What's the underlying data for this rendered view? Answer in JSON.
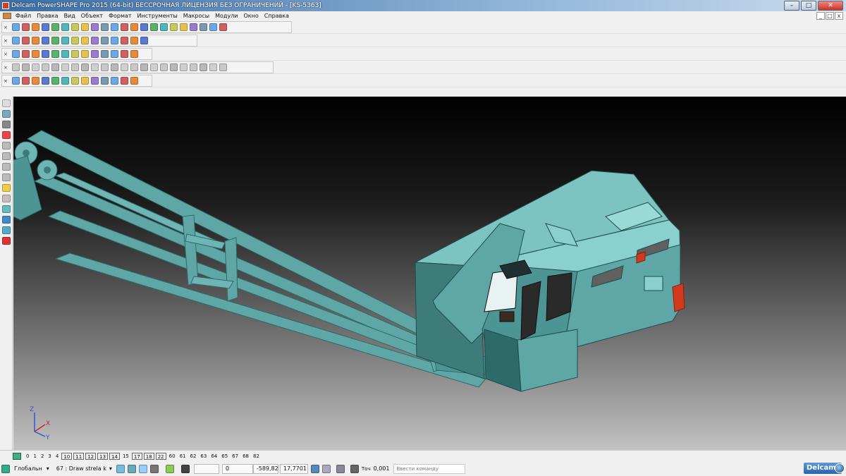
{
  "window": {
    "title": "Delcam PowerSHAPE Pro 2015 (64-bit) БЕССРОЧНАЯ ЛИЦЕНЗИЯ БЕЗ ОГРАНИЧЕНИЙ - [KS-5363]",
    "minimize": "–",
    "maximize": "□",
    "close": "✕"
  },
  "menu": {
    "items": [
      "Файл",
      "Правка",
      "Вид",
      "Объект",
      "Формат",
      "Инструменты",
      "Макросы",
      "Модули",
      "Окно",
      "Справка"
    ],
    "mdi_buttons": [
      "_",
      "□",
      "x"
    ]
  },
  "toolbars": {
    "row1_icons": [
      "new-icon",
      "open-icon",
      "save-icon",
      "save-as-icon",
      "print-icon",
      "cut-icon",
      "copy-icon",
      "paste-icon",
      "delete-icon",
      "undo-icon",
      "redo-icon",
      "text-icon",
      "measure-icon",
      "analysis-icon",
      "workplane-icon",
      "circle-icon",
      "curve-icon",
      "arc-icon",
      "surface-icon",
      "solid-icon",
      "mesh-icon",
      "tools-icon"
    ],
    "row2_icons": [
      "view-iso1-icon",
      "view-iso2-icon",
      "view-iso3-icon",
      "view-top-icon",
      "view-cube-icon",
      "rotate-icon",
      "zoom-icon",
      "zoom-in-icon",
      "zoom-out-icon",
      "center-icon",
      "shade-icon",
      "wireframe-icon",
      "render-icon",
      "hand-icon"
    ],
    "row3_icons": [
      "layer-icon",
      "document-icon",
      "folder-icon",
      "shape1-icon",
      "shape2-icon",
      "sphere-icon",
      "cone-icon",
      "cube-icon",
      "block-icon",
      "tree-icon",
      "grid-icon",
      "box-icon",
      "merge-icon"
    ],
    "row4_icons": [
      "select-icon",
      "solid-a-icon",
      "solid-b-icon",
      "solid-c-icon",
      "solid-d-icon",
      "solid-e-icon",
      "solid-f-icon",
      "solid-g-icon",
      "solid-h-icon",
      "solid-i-icon",
      "solid-j-icon",
      "solid-k-icon",
      "solid-l-icon",
      "solid-m-icon",
      "solid-n-icon",
      "solid-o-icon",
      "solid-p-icon",
      "solid-q-icon",
      "solid-r-icon",
      "solid-s-icon",
      "solid-t-icon",
      "solid-u-icon"
    ],
    "row5_icons": [
      "feature-icon",
      "fillet-icon",
      "chamfer-icon",
      "boolean-icon",
      "extrude-icon",
      "revolve-icon",
      "shell-icon",
      "cut-solid-icon",
      "pattern-icon",
      "mirror-icon",
      "split-icon",
      "draft-icon",
      "morph-icon"
    ]
  },
  "colors": {
    "model_body": "#5fa7a7",
    "model_body_light": "#7cc3c2",
    "model_body_dark": "#3e7c7c",
    "accent_red": "#d23a1e",
    "delcam_blue": "#2a62a8"
  },
  "levels": {
    "items": [
      "0",
      "1",
      "2",
      "3",
      "4",
      "10",
      "11",
      "12",
      "13",
      "14",
      "15",
      "17",
      "18",
      "22",
      "60",
      "61",
      "62",
      "63",
      "64",
      "65",
      "67",
      "68",
      "82"
    ],
    "boxed": [
      "10",
      "11",
      "12",
      "13",
      "14",
      "17",
      "18",
      "22"
    ]
  },
  "status": {
    "workplane": "Глобальн",
    "level": "67 : Draw strela k",
    "field1": "0",
    "x": "-589,82",
    "y": "17,7701",
    "tolerance_label": "Точ",
    "tolerance": "0,001",
    "command_placeholder": "Ввести команду",
    "logo": "Delcam"
  },
  "axis": {
    "x": "X",
    "y": "Y",
    "z": "Z"
  }
}
